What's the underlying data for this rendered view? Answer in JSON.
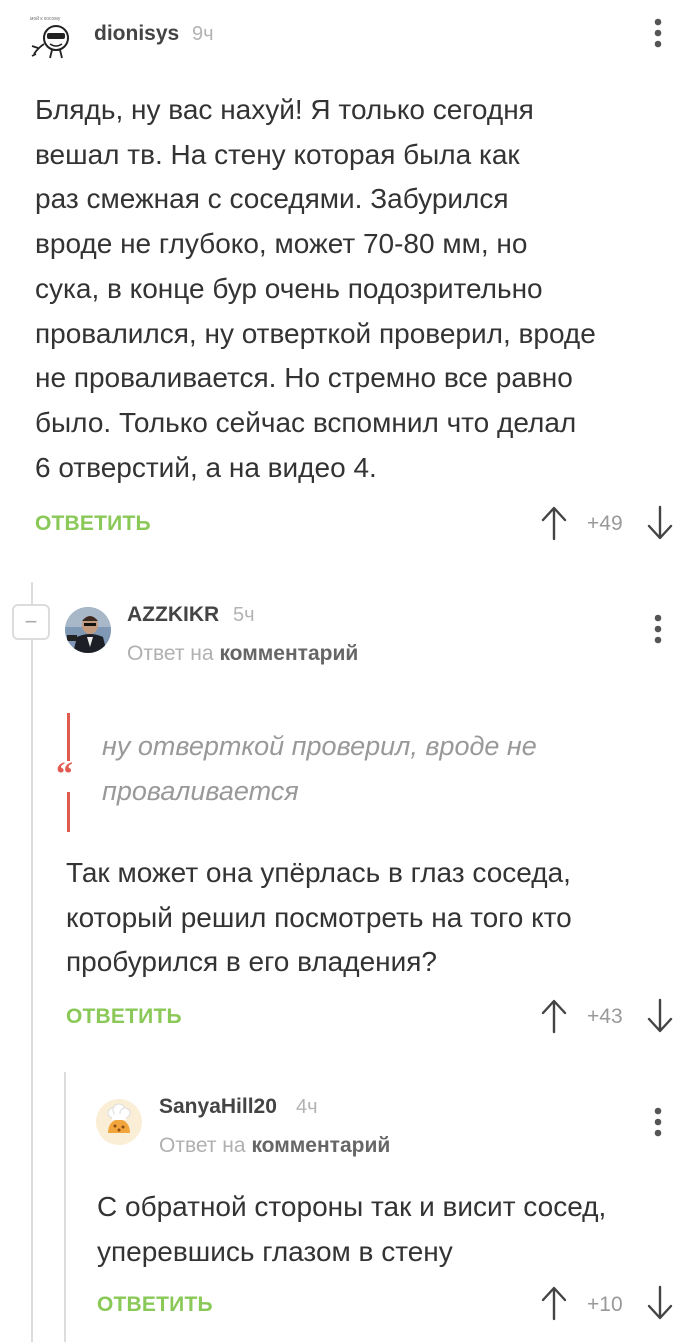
{
  "comments": [
    {
      "author": "dionisys",
      "time": "9ч",
      "text": [
        "Блядь, ну вас нахуй! Я только сегодня",
        "вешал тв. На стену которая была как",
        "раз смежная с соседями. Забурился",
        "вроде не глубоко, может 70-80 мм, но",
        "сука, в конце бур очень подозрительно",
        "провалился, ну отверткой проверил, вроде",
        "не проваливается. Но стремно все равно",
        "было. Только сейчас вспомнил что делал",
        "6 отверстий, а на видео 4."
      ],
      "reply_label": "ОТВЕТИТЬ",
      "score": "+49",
      "avatar_caption": "мой к косому"
    },
    {
      "author": "AZZKIKR",
      "time": "5ч",
      "reply_prefix": "Ответ на",
      "reply_target": "комментарий",
      "quote": [
        "ну отверткой проверил, вроде не",
        "проваливается"
      ],
      "text": [
        "Так может она упёрлась в глаз соседа,",
        "который решил посмотреть на того кто",
        "пробурился в его владения?"
      ],
      "reply_label": "ОТВЕТИТЬ",
      "score": "+43",
      "collapse_symbol": "−"
    },
    {
      "author": "SanyaHill20",
      "time": "4ч",
      "reply_prefix": "Ответ на",
      "reply_target": "комментарий",
      "text": [
        "С обратной стороны так и висит сосед,",
        "уперевшись глазом в стену"
      ],
      "reply_label": "ОТВЕТИТЬ",
      "score": "+10"
    }
  ],
  "colors": {
    "accent_green": "#8ac858",
    "quote_bar": "#e05a4f",
    "text": "#333333",
    "muted": "#b3b3b3"
  },
  "icons": [
    "kebab-menu-icon",
    "arrow-up-icon",
    "arrow-down-icon",
    "collapse-icon",
    "quote-icon"
  ]
}
